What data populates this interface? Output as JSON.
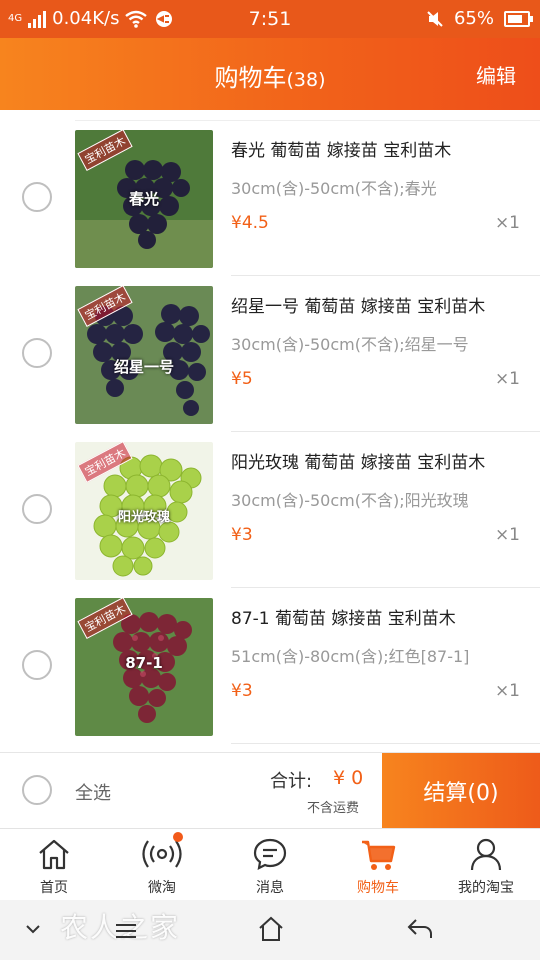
{
  "status_bar": {
    "network": "4G",
    "speed": "0.04K/s",
    "time": "7:51",
    "battery": "65%"
  },
  "header": {
    "title": "购物车",
    "count": "(38)",
    "edit": "编辑"
  },
  "items": [
    {
      "title": "春光 葡萄苗 嫁接苗 宝利苗木",
      "spec": "30cm(含)-50cm(不含);春光",
      "price": "¥4.5",
      "qty": "×1",
      "thumb_label": "春光",
      "thumb_stamp": "宝利苗木"
    },
    {
      "title": "绍星一号 葡萄苗 嫁接苗 宝利苗木",
      "spec": "30cm(含)-50cm(不含);绍星一号",
      "price": "¥5",
      "qty": "×1",
      "thumb_label": "绍星一号",
      "thumb_stamp": "宝利苗木"
    },
    {
      "title": "阳光玫瑰 葡萄苗 嫁接苗 宝利苗木",
      "spec": "30cm(含)-50cm(不含);阳光玫瑰",
      "price": "¥3",
      "qty": "×1",
      "thumb_label": "阳光玫瑰",
      "thumb_stamp": "宝利苗木"
    },
    {
      "title": "87-1 葡萄苗 嫁接苗 宝利苗木",
      "spec": "51cm(含)-80cm(含);红色[87-1]",
      "price": "¥3",
      "qty": "×1",
      "thumb_label": "87-1",
      "thumb_stamp": "宝利苗木"
    }
  ],
  "footer": {
    "select_all": "全选",
    "total_label": "合计:",
    "total_value": "¥ 0",
    "shipping_note": "不含运费",
    "checkout": "结算(0)"
  },
  "tabs": [
    {
      "label": "首页",
      "icon": "home-icon"
    },
    {
      "label": "微淘",
      "icon": "broadcast-icon"
    },
    {
      "label": "消息",
      "icon": "message-icon"
    },
    {
      "label": "购物车",
      "icon": "cart-icon"
    },
    {
      "label": "我的淘宝",
      "icon": "user-icon"
    }
  ],
  "watermark": "农人之家",
  "colors": {
    "accent": "#f26017",
    "header_start": "#f7841e",
    "header_end": "#ee4e1a",
    "status_bar": "#e8581a"
  }
}
